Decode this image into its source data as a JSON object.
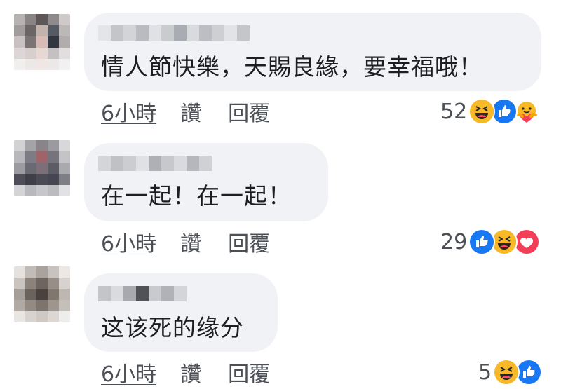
{
  "comments": [
    {
      "text": "情人節快樂，天賜良緣，要幸福哦！",
      "time": "6小時",
      "like_label": "讚",
      "reply_label": "回覆",
      "reaction_count": "52",
      "reactions": [
        "haha-icon",
        "like-icon",
        "care-icon"
      ]
    },
    {
      "text": "在一起！在一起！",
      "time": "6小時",
      "like_label": "讚",
      "reply_label": "回覆",
      "reaction_count": "29",
      "reactions": [
        "like-icon",
        "haha-icon",
        "love-icon"
      ]
    },
    {
      "text": "这该死的缘分",
      "time": "6小時",
      "like_label": "讚",
      "reply_label": "回覆",
      "reaction_count": "5",
      "reactions": [
        "haha-icon",
        "like-icon"
      ]
    }
  ],
  "colors": {
    "bubble": "#f0f2f5",
    "like_blue": "#1877f2",
    "haha_yellow": "#f7b928",
    "love_red": "#f33e58",
    "meta_gray": "#4b4f56"
  }
}
